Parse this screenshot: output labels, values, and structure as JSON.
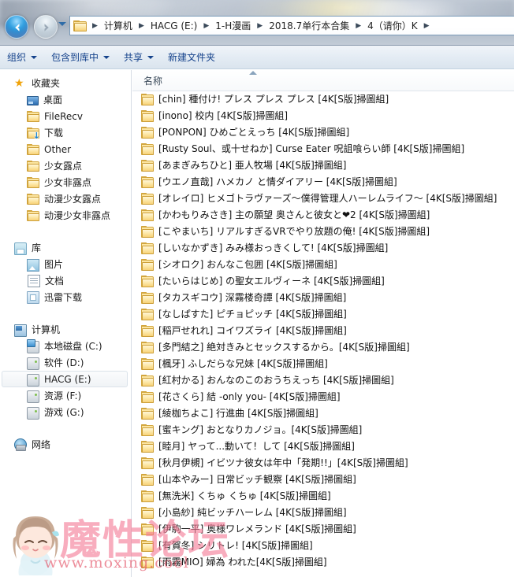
{
  "window": {
    "nav": {
      "back_label": "后退",
      "forward_label": "前进",
      "dropdown_label": "最近浏览的位置"
    },
    "address": {
      "folder_icon": "folder-icon",
      "crumbs": [
        "计算机",
        "HACG (E:)",
        "1-H漫画",
        "2018.7单行本合集",
        "4（请你）K"
      ],
      "separator": "▸"
    }
  },
  "command_bar": {
    "items": [
      {
        "label": "组织",
        "has_caret": true
      },
      {
        "label": "包含到库中",
        "has_caret": true
      },
      {
        "label": "共享",
        "has_caret": true
      },
      {
        "label": "新建文件夹",
        "has_caret": false
      }
    ]
  },
  "nav_pane": {
    "sections": [
      {
        "root": {
          "label": "收藏夹",
          "icon": "star-icon"
        },
        "items": [
          {
            "label": "桌面",
            "icon": "desktop-icon"
          },
          {
            "label": "FileRecv",
            "icon": "folder-icon"
          },
          {
            "label": "下载",
            "icon": "folder-download-icon"
          },
          {
            "label": "Other",
            "icon": "folder-icon"
          },
          {
            "label": "少女露点",
            "icon": "folder-icon"
          },
          {
            "label": "少女非露点",
            "icon": "folder-icon"
          },
          {
            "label": "动漫少女露点",
            "icon": "folder-icon"
          },
          {
            "label": "动漫少女非露点",
            "icon": "folder-icon"
          }
        ]
      },
      {
        "root": {
          "label": "库",
          "icon": "library-icon"
        },
        "items": [
          {
            "label": "图片",
            "icon": "pictures-icon"
          },
          {
            "label": "文档",
            "icon": "documents-icon"
          },
          {
            "label": "迅雷下载",
            "icon": "thunder-download-icon"
          }
        ]
      },
      {
        "root": {
          "label": "计算机",
          "icon": "computer-icon"
        },
        "items": [
          {
            "label": "本地磁盘 (C:)",
            "icon": "system-drive-icon",
            "selected": false
          },
          {
            "label": "软件 (D:)",
            "icon": "drive-icon",
            "selected": false
          },
          {
            "label": "HACG (E:)",
            "icon": "drive-icon",
            "selected": true
          },
          {
            "label": "资源 (F:)",
            "icon": "drive-icon",
            "selected": false
          },
          {
            "label": "游戏 (G:)",
            "icon": "drive-icon",
            "selected": false
          }
        ]
      },
      {
        "root": {
          "label": "网络",
          "icon": "network-icon"
        },
        "items": []
      }
    ]
  },
  "file_list": {
    "column_header": "名称",
    "sort_direction": "ascending",
    "rows": [
      {
        "name": "[chin] 種付け! プレス プレス プレス [4K[S版]掃圖組]",
        "icon": "folder-icon"
      },
      {
        "name": "[inono] 校内 [4K[S版]掃圖組]",
        "icon": "folder-icon"
      },
      {
        "name": "[PONPON] ひめごとえっち [4K[S版]掃圖組]",
        "icon": "folder-icon"
      },
      {
        "name": "[Rusty Soul、或十せねか] Curse Eater 呪詛喰らい師 [4K[S版]掃圖組]",
        "icon": "folder-icon"
      },
      {
        "name": "[あまぎみちひと] 亜人牧場 [4K[S版]掃圖組]",
        "icon": "folder-icon"
      },
      {
        "name": "[ウエノ直哉] ハメカノ と情ダイアリー [4K[S版]掃圖組]",
        "icon": "folder-icon"
      },
      {
        "name": "[オレイロ] ヒメゴトラヴァーズ～僕得管理人ハーレムライフ～ [4K[S版]掃圖組]",
        "icon": "folder-icon"
      },
      {
        "name": "[かわもりみさき] 主の願望 奥さんと彼女と❤2 [4K[S版]掃圖組]",
        "icon": "folder-icon"
      },
      {
        "name": "[こやまいち] リアルすぎるVRでやり放題の俺! [4K[S版]掃圖組]",
        "icon": "folder-icon"
      },
      {
        "name": "[しいなかずき] みみ様おっきくして! [4K[S版]掃圖組]",
        "icon": "folder-icon"
      },
      {
        "name": "[シオロク] おんなこ包囲 [4K[S版]掃圖組]",
        "icon": "folder-icon"
      },
      {
        "name": "[たいらはじめ] の聖女エルヴィーネ [4K[S版]掃圖組]",
        "icon": "folder-icon"
      },
      {
        "name": "[タカスギコウ] 深霧楼奇譚 [4K[S版]掃圖組]",
        "icon": "folder-icon"
      },
      {
        "name": "[なしぱすた] ピチョピッチ [4K[S版]掃圖組]",
        "icon": "folder-icon"
      },
      {
        "name": "[稲戸せれれ] コイワズライ [4K[S版]掃圖組]",
        "icon": "folder-icon"
      },
      {
        "name": "[多門結之] 絶対きみとセックスするから。[4K[S版]掃圖組]",
        "icon": "folder-icon"
      },
      {
        "name": "[楓牙] ふしだらな兄妹 [4K[S版]掃圖組]",
        "icon": "folder-icon"
      },
      {
        "name": "[紅村かる] おんなのこのおうちえっち [4K[S版]掃圖組]",
        "icon": "folder-icon"
      },
      {
        "name": "[花さくら] 結 -only you- [4K[S版]掃圖組]",
        "icon": "folder-icon"
      },
      {
        "name": "[綾枷ちよこ] 行進曲 [4K[S版]掃圖組]",
        "icon": "folder-icon"
      },
      {
        "name": "[蜜キング] おとなりカノジョ。[4K[S版]掃圖組]",
        "icon": "folder-icon"
      },
      {
        "name": "[睦月] ヤって...動いて！して [4K[S版]掃圖組]",
        "icon": "folder-icon"
      },
      {
        "name": "[秋月伊槻] イビツナ彼女は年中「発期!!」[4K[S版]掃圖組]",
        "icon": "folder-icon"
      },
      {
        "name": "[山本やみー] 日常ビッチ観察 [4K[S版]掃圖組]",
        "icon": "folder-icon"
      },
      {
        "name": "[無洗米] くちゅ くちゅ [4K[S版]掃圖組]",
        "icon": "folder-icon"
      },
      {
        "name": "[小島紗] 純ビッチハーレム [4K[S版]掃圖組]",
        "icon": "folder-icon"
      },
      {
        "name": "[伊駒一平] 奥様ワレメランド [4K[S版]掃圖組]",
        "icon": "folder-icon"
      },
      {
        "name": "[有賀冬] シリトレ! [4K[S版]掃圖組]",
        "icon": "folder-icon"
      },
      {
        "name": "[雨霧MIO] 婦為 われた[4K[S版]掃圖組]",
        "icon": "folder-icon"
      }
    ]
  },
  "watermark": {
    "title": "魔性论坛",
    "url": "www.moxing.cool",
    "character": "cartoon-girl"
  },
  "colors": {
    "accent": "#15428b",
    "folder": "#f6d071",
    "watermark_pink": "#f37a96",
    "selection": "#f0f3f6"
  }
}
